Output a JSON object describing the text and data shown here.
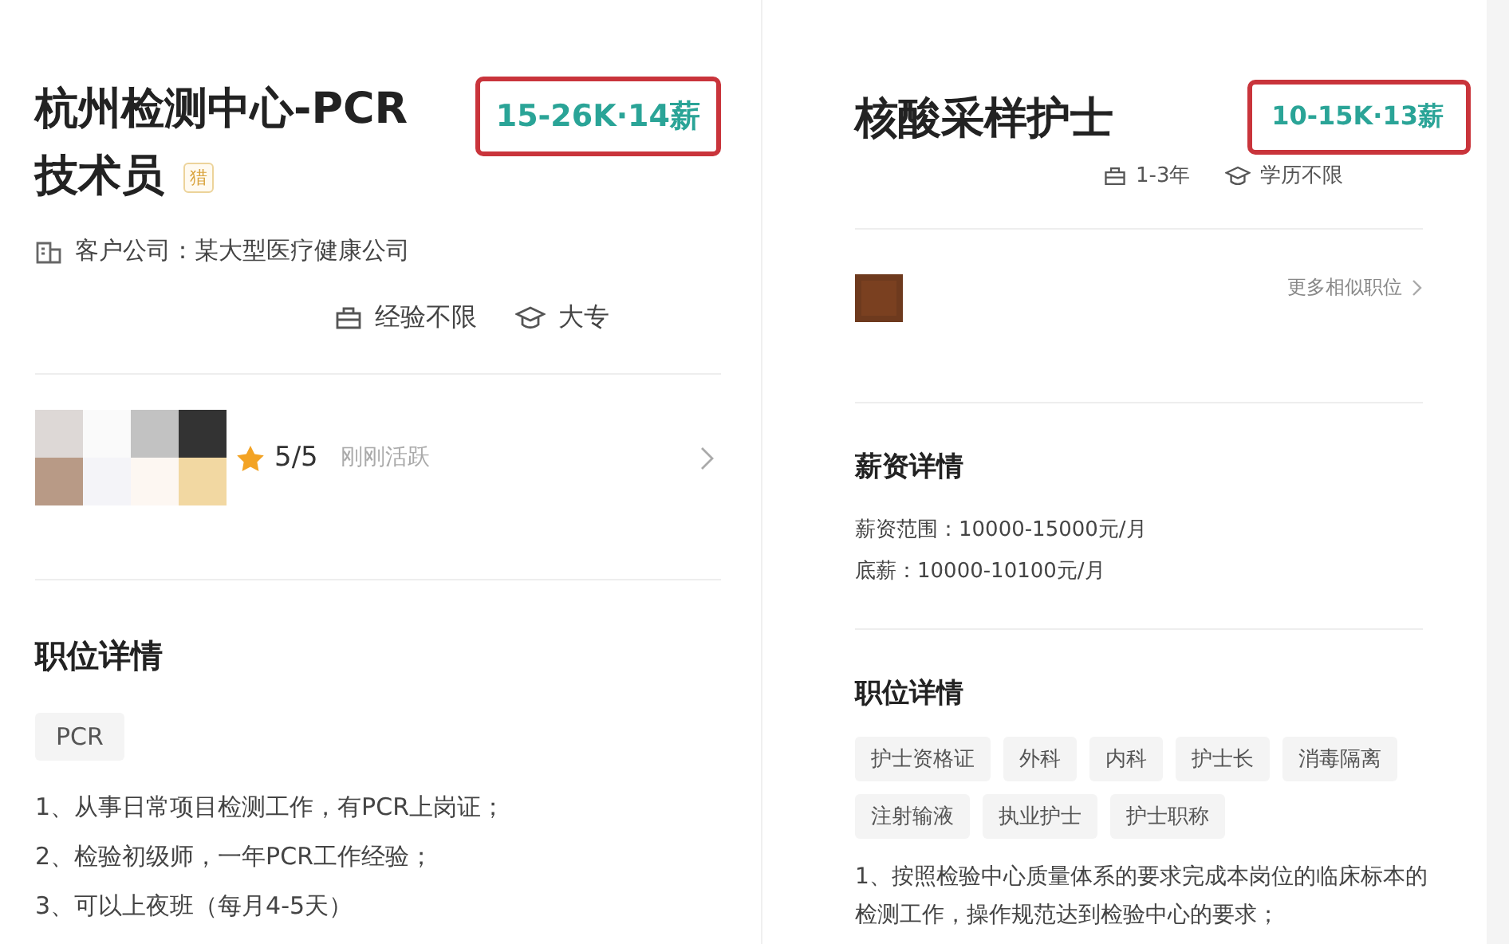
{
  "left": {
    "title_lines": [
      "杭州检测中心-PCR",
      "技术员"
    ],
    "badge": "猎",
    "salary": "15-26K·14薪",
    "company": "客户公司：某大型医疗健康公司",
    "requirements": [
      {
        "kind": "experience",
        "text": "经验不限"
      },
      {
        "kind": "education",
        "text": "大专"
      }
    ],
    "recruiter": {
      "rating": "5/5",
      "status": "刚刚活跃"
    },
    "section_title": "职位详情",
    "tags": [
      "PCR"
    ],
    "duties": [
      "1、从事日常项目检测工作，有PCR上岗证；",
      "2、检验初级师，一年PCR工作经验；",
      "3、可以上夜班（每月4-5天）"
    ]
  },
  "right": {
    "title": "核酸采样护士",
    "salary": "10-15K·13薪",
    "requirements": [
      {
        "kind": "experience",
        "text": "1-3年"
      },
      {
        "kind": "education",
        "text": "学历不限"
      }
    ],
    "more_link": "更多相似职位",
    "salary_section_title": "薪资详情",
    "salary_details": [
      "薪资范围：10000-15000元/月",
      "底薪：10000-10100元/月"
    ],
    "section_title": "职位详情",
    "tags": [
      "护士资格证",
      "外科",
      "内科",
      "护士长",
      "消毒隔离",
      "注射输液",
      "执业护士",
      "护士职称"
    ],
    "description": "1、按照检验中心质量体系的要求完成本岗位的临床标本的检测工作，操作规范达到检验中心的要求；"
  }
}
